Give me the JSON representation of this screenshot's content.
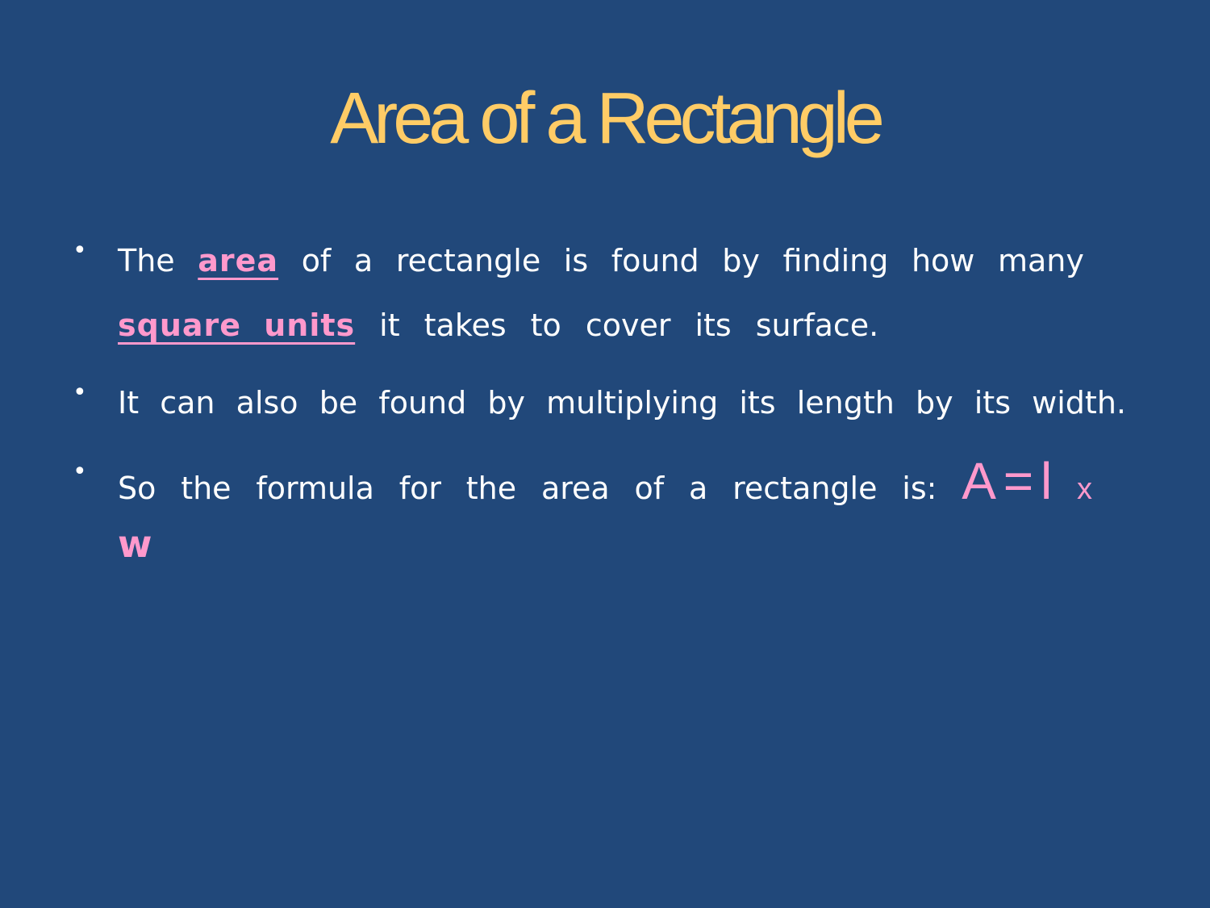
{
  "slide": {
    "title": "Area of a Rectangle",
    "bullets": [
      {
        "line1_words": [
          "The",
          "area",
          "of",
          "a",
          "rectangle",
          "is",
          "found",
          "by",
          "finding",
          "how",
          "many"
        ],
        "line2_words": [
          "square units",
          "it",
          "takes",
          "to",
          "cover",
          "its",
          "surface."
        ]
      },
      {
        "line1_words": [
          "It",
          "can",
          "also",
          "be",
          "found",
          "by",
          "multiplying",
          "its",
          "length",
          "by",
          "its",
          "width."
        ]
      },
      {
        "line1_words": [
          "So",
          "the",
          "formula",
          "for",
          "the",
          "area",
          "of",
          "a",
          "rectangle",
          "is:"
        ],
        "formula": {
          "a": "A",
          "eq": "=",
          "l": "l",
          "times": "x",
          "w": "w"
        }
      }
    ],
    "bullet_symbol": "•"
  },
  "colors": {
    "background": "#21487a",
    "title": "#ffcc66",
    "body_text": "#ffffff",
    "emphasis": "#ff99cc"
  }
}
